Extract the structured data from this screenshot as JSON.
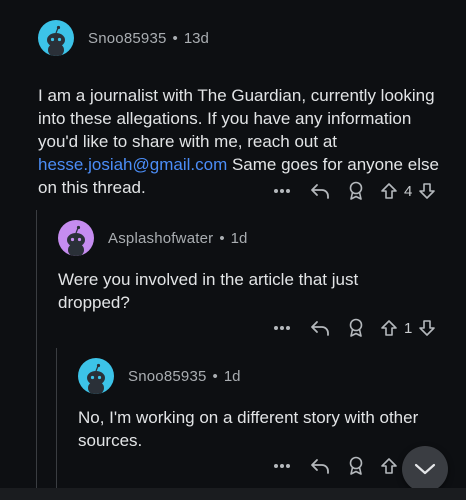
{
  "comments": [
    {
      "username": "Snoo85935",
      "separator": "•",
      "age": "13d",
      "body_before_link": "I am a journalist with The Guardian, currently looking into these allegations. If you have any information you'd like to share with me, reach out at ",
      "link": "hesse.josiah@gmail.com",
      "body_after_link": " Same goes for anyone else on this thread.",
      "votes": "4",
      "avatar_color": "#3cc3e8"
    },
    {
      "username": "Asplashofwater",
      "separator": "•",
      "age": "1d",
      "body": "Were you involved in the article that just dropped?",
      "votes": "1",
      "avatar_color": "#c58cf0"
    },
    {
      "username": "Snoo85935",
      "separator": "•",
      "age": "1d",
      "body": "No, I'm working on a different story with other sources.",
      "votes": "",
      "avatar_color": "#3cc3e8"
    }
  ],
  "icons": {
    "more": "more-options-icon",
    "reply": "reply-icon",
    "award": "award-icon",
    "upvote": "upvote-icon",
    "downvote": "downvote-icon",
    "scroll": "chevron-down-icon"
  },
  "colors": {
    "background": "#0d0f12",
    "link": "#4b8df7",
    "text": "#e2e4e6",
    "meta": "#a9adb1"
  }
}
